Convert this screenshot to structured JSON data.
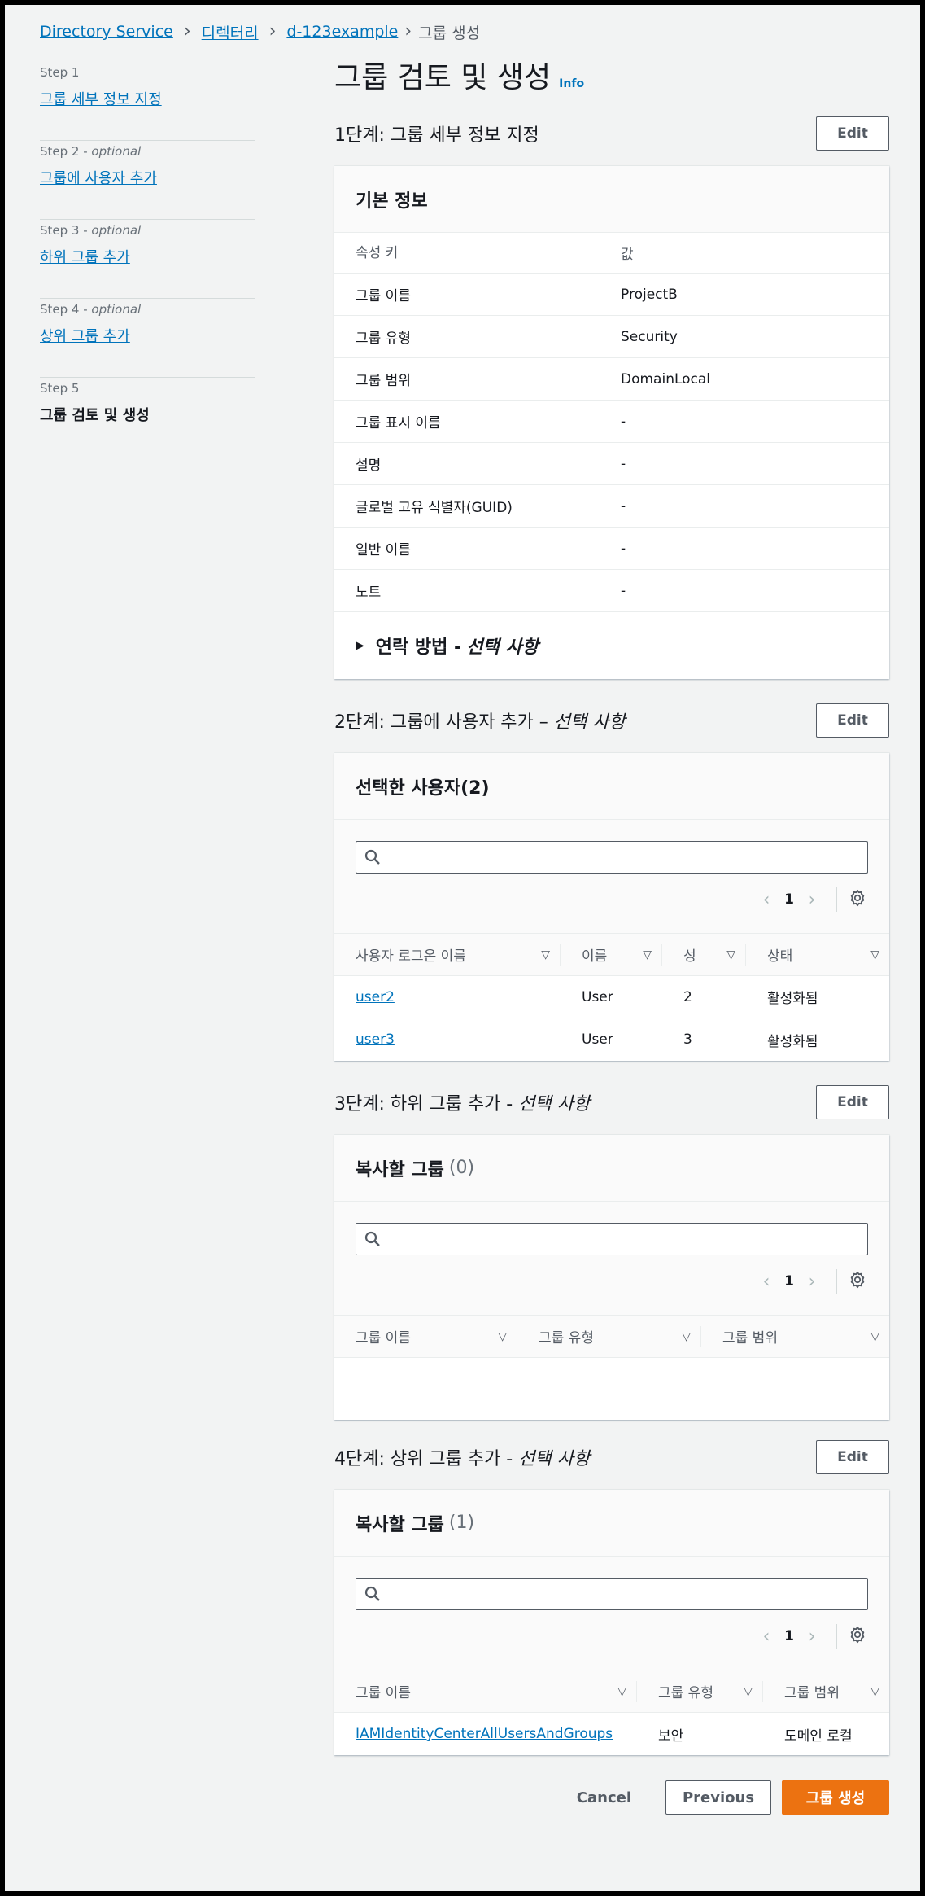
{
  "breadcrumb": {
    "items": [
      "Directory Service",
      "디렉터리",
      "d-123example"
    ],
    "current": "그룹 생성"
  },
  "steps": [
    {
      "label": "Step 1",
      "optional": "",
      "name": "그룹 세부 정보 지정"
    },
    {
      "label": "Step 2 - ",
      "optional": "optional",
      "name": "그룹에 사용자 추가"
    },
    {
      "label": "Step 3 - ",
      "optional": "optional",
      "name": "하위 그룹 추가"
    },
    {
      "label": "Step 4 - ",
      "optional": "optional",
      "name": "상위 그룹 추가"
    },
    {
      "label": "Step 5",
      "optional": "",
      "name": "그룹 검토 및 생성"
    }
  ],
  "page": {
    "title": "그룹 검토 및 생성",
    "info": "Info"
  },
  "edit_label": "Edit",
  "section1": {
    "title": "1단계: 그룹 세부 정보 지정",
    "card_title": "기본 정보",
    "col_key": "속성 키",
    "col_value": "값",
    "rows": [
      {
        "k": "그룹 이름",
        "v": "ProjectB"
      },
      {
        "k": "그룹 유형",
        "v": "Security"
      },
      {
        "k": "그룹 범위",
        "v": "DomainLocal"
      },
      {
        "k": "그룹 표시 이름",
        "v": "-"
      },
      {
        "k": "설명",
        "v": "-"
      },
      {
        "k": "글로벌 고유 식별자(GUID)",
        "v": "-"
      },
      {
        "k": "일반 이름",
        "v": "-"
      },
      {
        "k": "노트",
        "v": "-"
      }
    ],
    "expander_main": "연락 방법 - ",
    "expander_italic": "선택 사항"
  },
  "section2": {
    "title_main": "2단계: 그룹에 사용자 추가 – ",
    "title_italic": "선택 사항",
    "card_title": "선택한 사용자(2)",
    "page": "1",
    "columns": [
      "사용자 로그온 이름",
      "이름",
      "성",
      "상태"
    ],
    "rows": [
      {
        "logon": "user2",
        "name": "User",
        "last": "2",
        "status": "활성화됨"
      },
      {
        "logon": "user3",
        "name": "User",
        "last": "3",
        "status": "활성화됨"
      }
    ]
  },
  "section3": {
    "title_main": "3단계: 하위 그룹 추가 - ",
    "title_italic": "선택 사항",
    "card_title": "복사할 그룹",
    "count": "(0)",
    "page": "1",
    "columns": [
      "그룹 이름",
      "그룹 유형",
      "그룹 범위"
    ]
  },
  "section4": {
    "title_main": "4단계: 상위 그룹 추가 - ",
    "title_italic": "선택 사항",
    "card_title": "복사할 그룹",
    "count": "(1)",
    "page": "1",
    "columns": [
      "그룹 이름",
      "그룹 유형",
      "그룹 범위"
    ],
    "rows": [
      {
        "name": "IAMIdentityCenterAllUsersAndGroups",
        "type": "보안",
        "scope": "도메인 로컬"
      }
    ]
  },
  "footer": {
    "cancel": "Cancel",
    "previous": "Previous",
    "create": "그룹 생성"
  },
  "colors": {
    "link": "#0073bb",
    "primary": "#ec7211",
    "background": "#f2f3f3"
  }
}
